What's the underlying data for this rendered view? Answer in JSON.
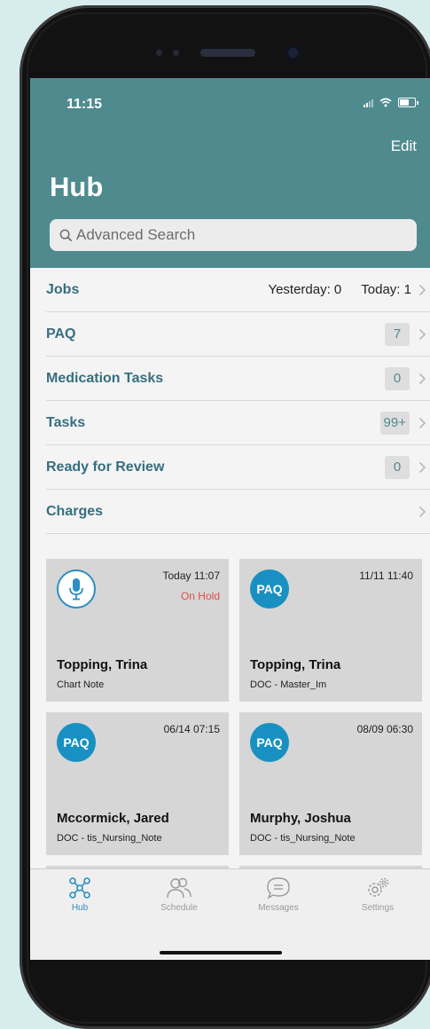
{
  "status_bar": {
    "time": "11:15"
  },
  "header": {
    "edit_label": "Edit",
    "title": "Hub",
    "search_placeholder": "Advanced Search"
  },
  "rows": {
    "jobs": {
      "label": "Jobs",
      "yesterday": "Yesterday: 0",
      "today": "Today: 1"
    },
    "paq": {
      "label": "PAQ",
      "count": "7"
    },
    "medication_tasks": {
      "label": "Medication Tasks",
      "count": "0"
    },
    "tasks": {
      "label": "Tasks",
      "count": "99+"
    },
    "ready_for_review": {
      "label": "Ready for Review",
      "count": "0"
    },
    "charges": {
      "label": "Charges"
    }
  },
  "cards": [
    {
      "icon": "microphone-icon",
      "date": "Today 11:07",
      "status": "On Hold",
      "name": "Topping, Trina",
      "doc": "Chart Note"
    },
    {
      "icon": "PAQ",
      "date": "11/11 11:40",
      "status": "",
      "name": "Topping, Trina",
      "doc": "DOC - Master_Im"
    },
    {
      "icon": "PAQ",
      "date": "06/14 07:15",
      "status": "",
      "name": "Mccormick, Jared",
      "doc": "DOC - tis_Nursing_Note"
    },
    {
      "icon": "PAQ",
      "date": "08/09 06:30",
      "status": "",
      "name": "Murphy, Joshua",
      "doc": "DOC - tis_Nursing_Note"
    }
  ],
  "tabbar": {
    "hub": "Hub",
    "schedule": "Schedule",
    "messages": "Messages",
    "settings": "Settings"
  },
  "colors": {
    "header": "#4f8a8f",
    "accent": "#2b8fc4",
    "row_label": "#356f80",
    "on_hold": "#e24c4c"
  }
}
